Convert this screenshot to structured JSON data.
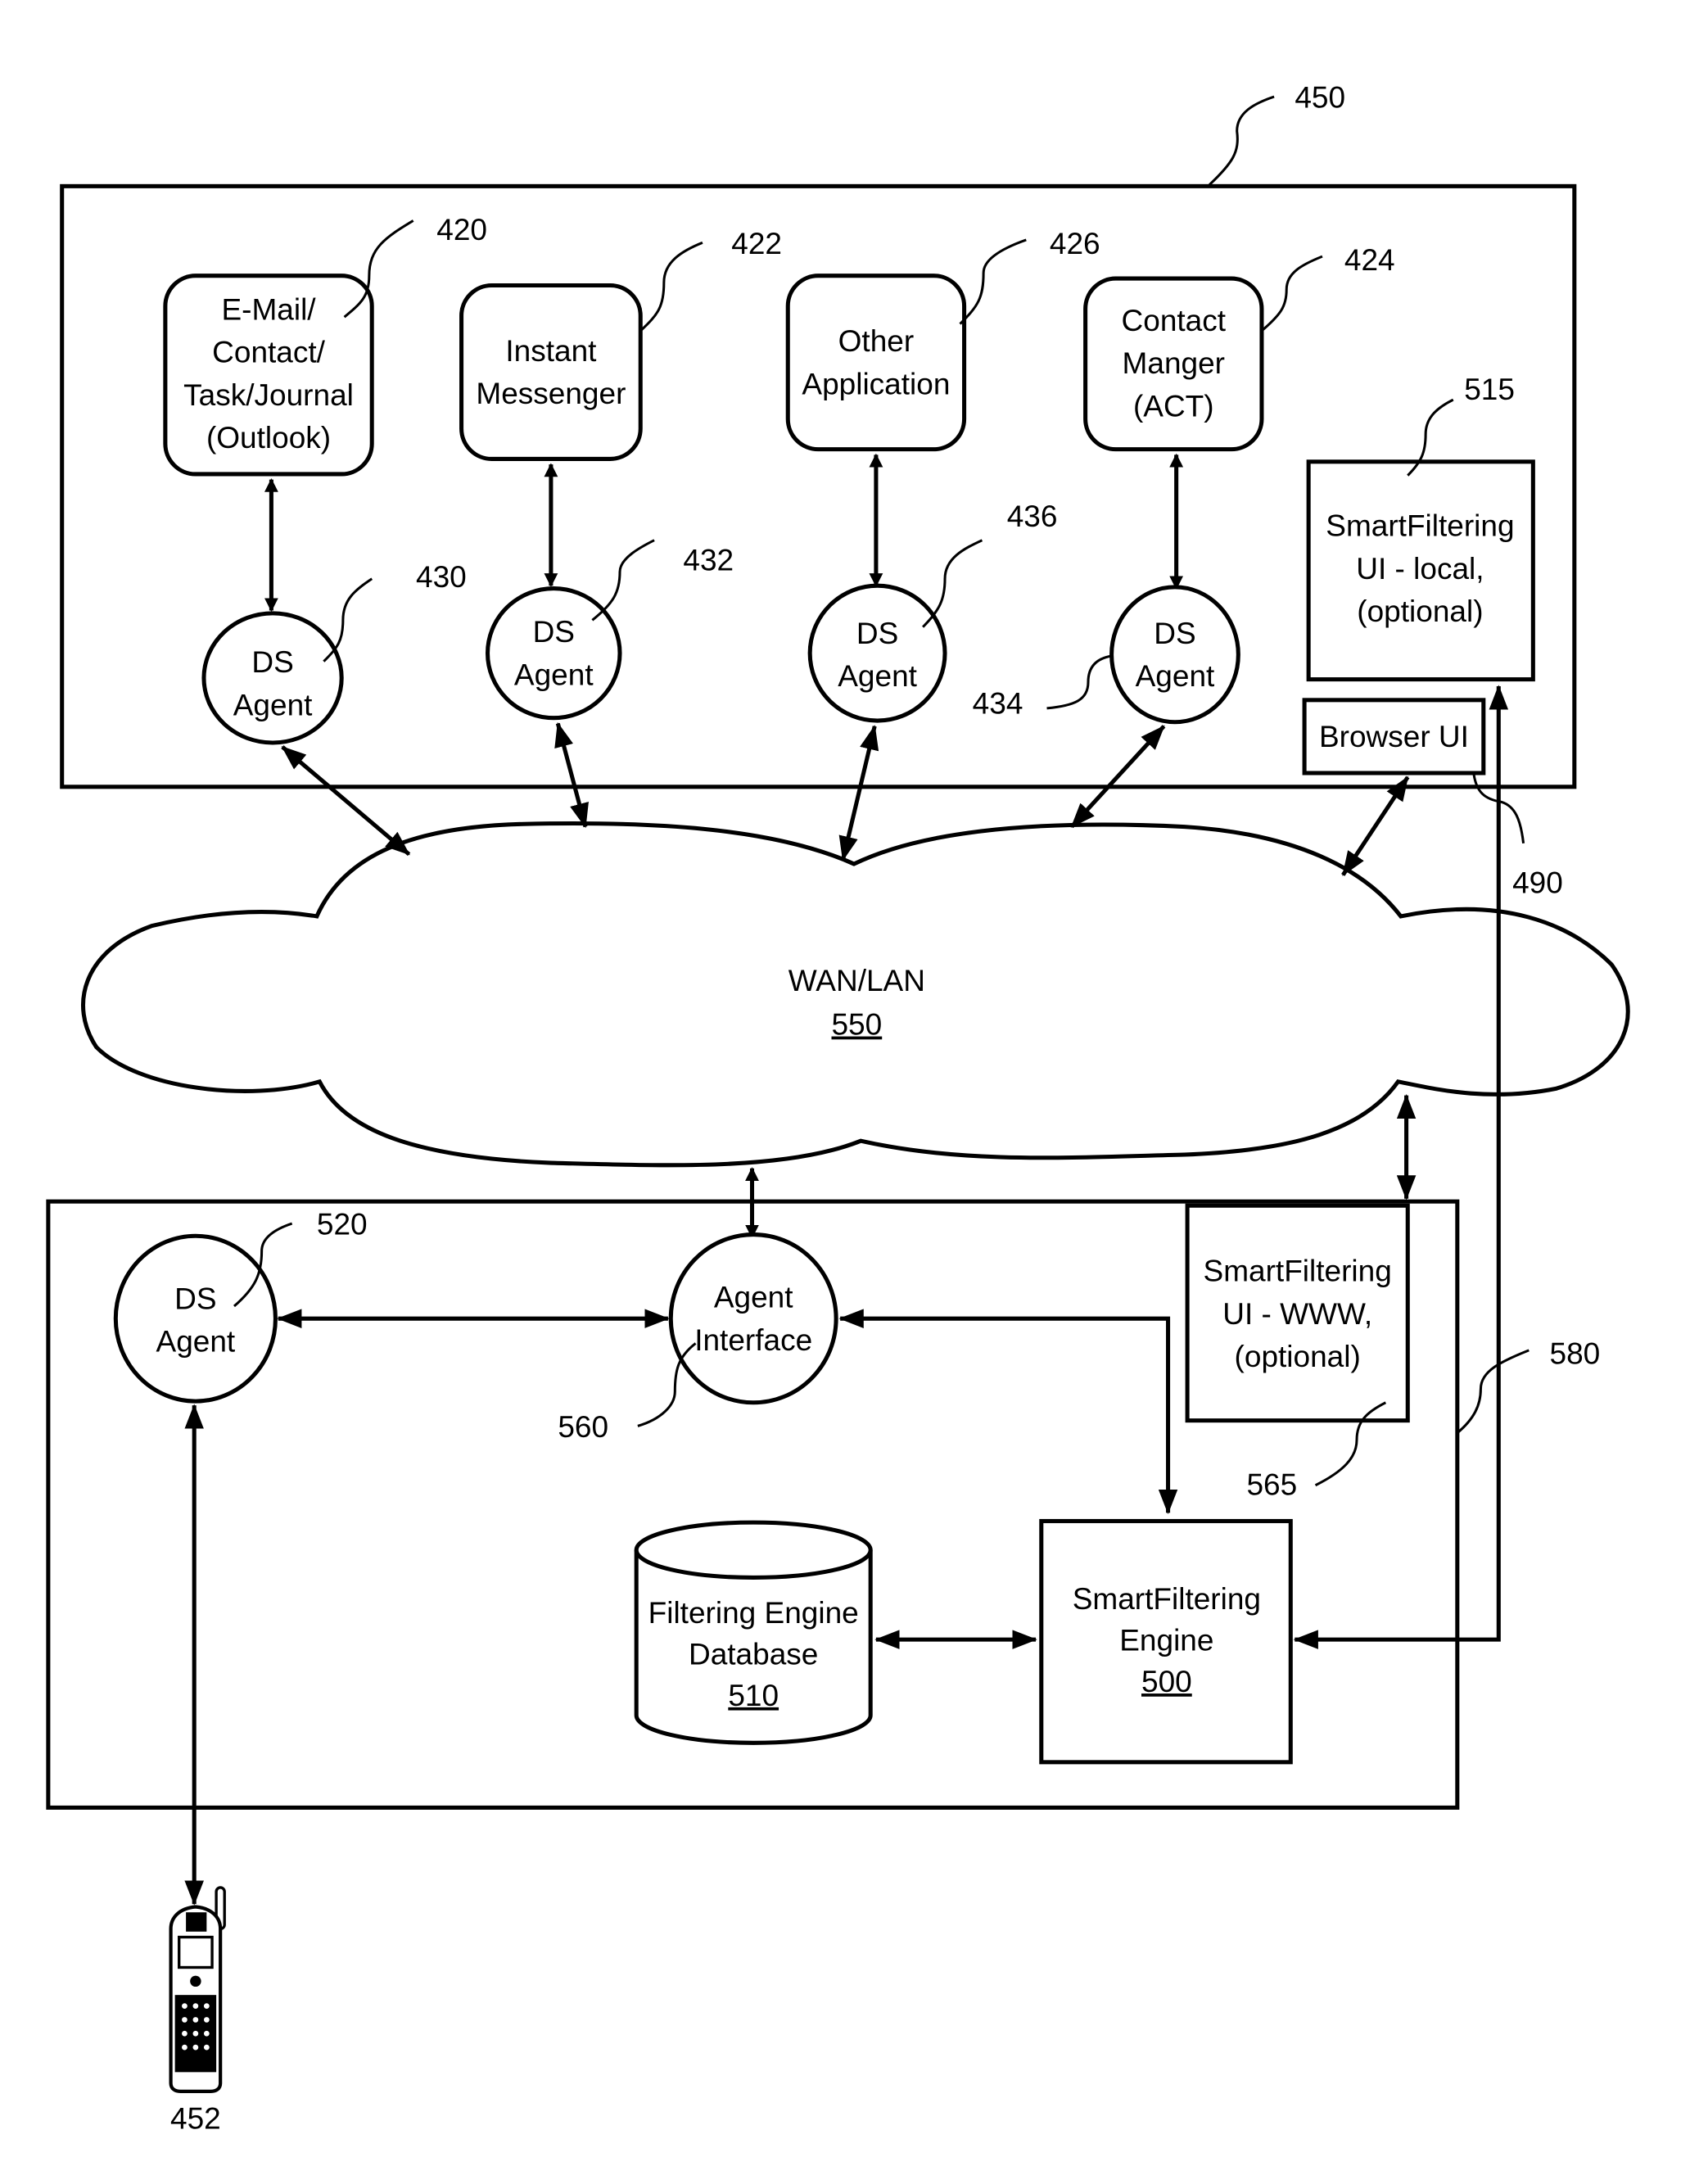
{
  "diagram": {
    "client_system": {
      "ref": "450"
    },
    "applications": [
      {
        "ref": "420",
        "lines": [
          "E-Mail/",
          "Contact/",
          "Task/Journal",
          "(Outlook)"
        ]
      },
      {
        "ref": "422",
        "lines": [
          "Instant",
          "Messenger"
        ]
      },
      {
        "ref": "426",
        "lines": [
          "Other",
          "Application"
        ]
      },
      {
        "ref": "424",
        "lines": [
          "Contact",
          "Manger",
          "(ACT)"
        ]
      }
    ],
    "client_agents": [
      {
        "ref": "430",
        "lines": [
          "DS",
          "Agent"
        ]
      },
      {
        "ref": "432",
        "lines": [
          "DS",
          "Agent"
        ]
      },
      {
        "ref": "436",
        "lines": [
          "DS",
          "Agent"
        ]
      },
      {
        "ref": "434",
        "lines": [
          "DS",
          "Agent"
        ]
      }
    ],
    "smartfiltering_ui_local": {
      "ref": "515",
      "lines": [
        "SmartFiltering",
        "UI - local,",
        "(optional)"
      ]
    },
    "browser_ui": {
      "ref": "490",
      "label": "Browser UI"
    },
    "network": {
      "label": "WAN/LAN",
      "ref": "550"
    },
    "server_agent": {
      "ref": "520",
      "lines": [
        "DS",
        "Agent"
      ]
    },
    "agent_interface": {
      "ref": "560",
      "lines": [
        "Agent",
        "Interface"
      ]
    },
    "smartfiltering_ui_www": {
      "ref": "565",
      "lines": [
        "SmartFiltering",
        "UI - WWW,",
        "(optional)"
      ]
    },
    "connection_580": {
      "ref": "580"
    },
    "database": {
      "lines": [
        "Filtering Engine",
        "Database"
      ],
      "ref": "510"
    },
    "engine": {
      "lines": [
        "SmartFiltering",
        "Engine"
      ],
      "ref": "500"
    },
    "mobile_device": {
      "ref": "452"
    }
  }
}
